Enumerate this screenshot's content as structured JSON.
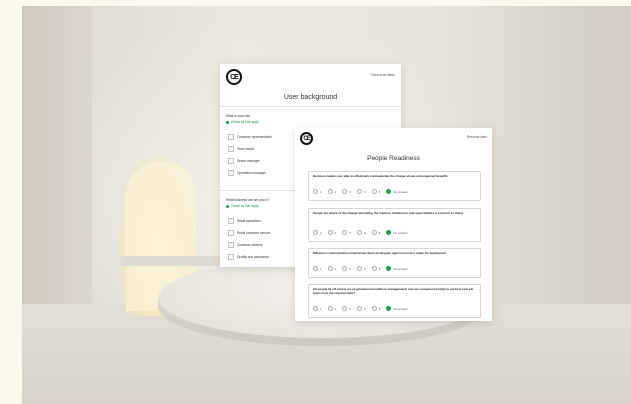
{
  "back_card": {
    "logo": "CE",
    "resume_label": "Resume later",
    "title": "User background",
    "question1": {
      "label": "What is your role",
      "hint": "Check all that apply",
      "options": [
        "Customer representative",
        "Team leader",
        "Senior manager",
        "Operations manager"
      ]
    },
    "question2": {
      "label": "What business unit are you in?",
      "hint": "Check all that apply",
      "options": [
        "Retail operations",
        "Retail customer service",
        "Customer delivery",
        "Quality and assurance"
      ]
    }
  },
  "front_card": {
    "logo": "CE",
    "resume_label": "Resume later",
    "title": "People Readiness",
    "scale_labels": [
      "1",
      "2",
      "3",
      "4",
      "5"
    ],
    "no_answer_label": "No answer",
    "questions": [
      {
        "text": "Business leaders are able to effectively communicate the change vision and expected benefits"
      },
      {
        "text": "People are aware of the change (including the impacts, timeframes and opportunities it presents to them)"
      },
      {
        "text": "Effective communication material has been developed, approved and is ready for deployment"
      },
      {
        "text": "All people (& off-shore) are programmed (workforce management) and are competent (ready) to perform new job tasks from the required date?"
      }
    ]
  },
  "colors": {
    "accent_green": "#1a9c4c",
    "background": "#fdf8ec"
  },
  "icons": {
    "logo": "ce-logo-icon",
    "radio_selected": "radio-selected-icon",
    "checkbox": "checkbox-icon"
  }
}
